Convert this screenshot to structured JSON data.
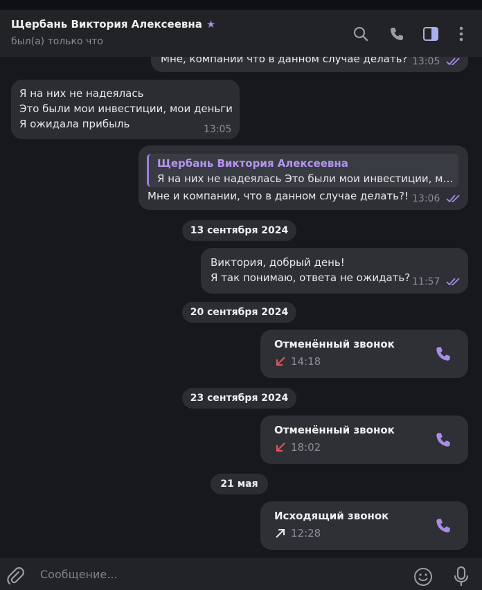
{
  "header": {
    "contact_name": "Щербань Виктория Алексеевна",
    "status": "был(а) только что",
    "icons": [
      "search-icon",
      "phone-icon",
      "sidebar-toggle-icon",
      "more-vertical-icon"
    ]
  },
  "messages": [
    {
      "direction": "out",
      "text": "Мне, компании что в данном случае делать?",
      "time": "13:05",
      "read": true
    },
    {
      "direction": "in",
      "lines": [
        "Я на них не надеялась",
        "Это были мои инвестиции, мои деньги",
        "Я ожидала прибыль"
      ],
      "time": "13:05"
    },
    {
      "direction": "out",
      "reply_to": {
        "name": "Щербань Виктория Алексеевна",
        "text": "Я на них не надеялась  Это были мои инвестиции, мои деньги"
      },
      "text": "Мне и компании, что в данном случае делать?!",
      "time": "13:06",
      "read": true
    }
  ],
  "date_separators": [
    "13 сентября 2024",
    "20 сентября 2024",
    "23 сентября 2024",
    "21 мая"
  ],
  "message_sep13": {
    "lines": [
      "Виктория, добрый день!",
      "Я так понимаю, ответа не ожидать?"
    ],
    "time": "11:57",
    "read": true
  },
  "calls": [
    {
      "title": "Отменённый звонок",
      "time": "14:18",
      "arrow": "missed-call-arrow-icon"
    },
    {
      "title": "Отменённый звонок",
      "time": "18:02",
      "arrow": "missed-call-arrow-icon"
    },
    {
      "title": "Исходящий звонок",
      "time": "12:28",
      "arrow": "outgoing-call-arrow-icon"
    }
  ],
  "composer": {
    "placeholder": "Сообщение..."
  },
  "colors": {
    "accent": "#a98ce8",
    "missed": "#e0585a",
    "bubble_in": "#2b2d33",
    "bubble_out": "#2e3036",
    "background": "#16181c"
  }
}
